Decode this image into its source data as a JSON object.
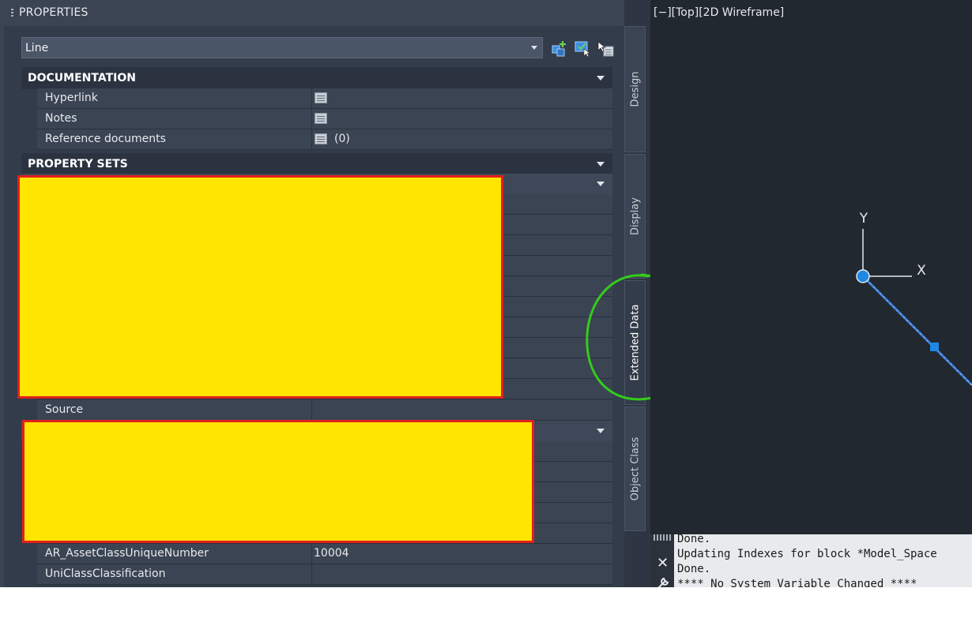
{
  "palette": {
    "title": "PROPERTIES",
    "object_type": "Line",
    "toolbar_icons": [
      "add-to-selection-icon",
      "quick-select-icon",
      "select-objects-icon"
    ],
    "sections": {
      "documentation": {
        "title": "DOCUMENTATION",
        "rows": [
          {
            "label": "Hyperlink",
            "value": ""
          },
          {
            "label": "Notes",
            "value": ""
          },
          {
            "label": "Reference documents",
            "value": "(0)"
          }
        ]
      },
      "property_sets": {
        "title": "PROPERTY SETS",
        "rows": [
          {
            "label": "Source",
            "value": ""
          },
          {
            "label": "AR_AssetClassUniqueNumber",
            "value": "10004"
          },
          {
            "label": "UniClassClassification",
            "value": ""
          }
        ]
      }
    }
  },
  "tabs": [
    {
      "label": "Design",
      "active": false
    },
    {
      "label": "Display",
      "active": false
    },
    {
      "label": "Extended Data",
      "active": true
    },
    {
      "label": "Object Class",
      "active": false
    }
  ],
  "viewport": {
    "label": "[−][Top][2D Wireframe]",
    "axis_x": "X",
    "axis_y": "Y"
  },
  "command_line": {
    "lines": [
      "Done.",
      "Updating Indexes for block *Model_Space",
      "Done.",
      "**** No System Variable Changed ****"
    ]
  },
  "colors": {
    "redaction_fill": "#ffe500",
    "redaction_border": "#e3201b",
    "annotation_circle": "#33cc1a",
    "selected_line": "#3a7bd5",
    "grip": "#1e88e5"
  }
}
